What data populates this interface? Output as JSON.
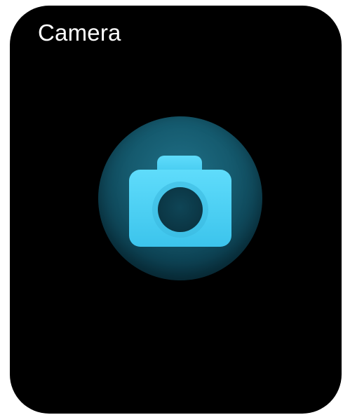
{
  "app": {
    "title": "Camera"
  },
  "launcher": {
    "icon": "camera-icon",
    "colors": {
      "background": "#000000",
      "circle": "#155a6e",
      "icon_body": "#4fd3f5",
      "lens": "#0d3a4a"
    }
  }
}
